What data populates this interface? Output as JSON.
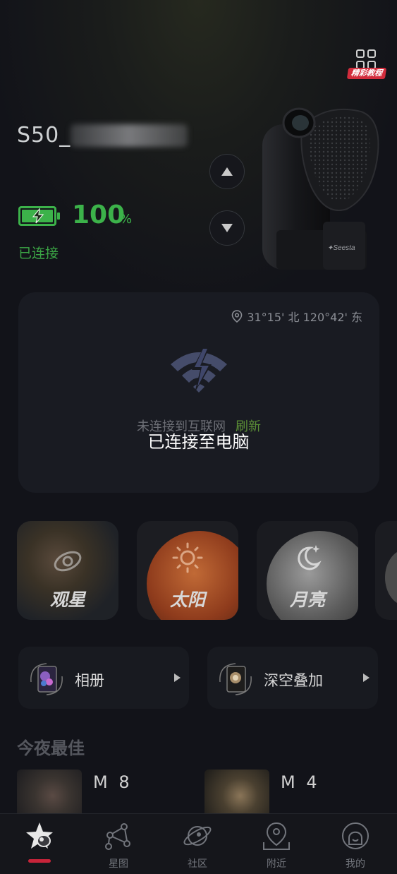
{
  "header": {
    "tutorial_label": "精彩教程",
    "device_name": "S50_",
    "battery": {
      "value": "100",
      "unit": "%",
      "level": 1.0
    },
    "connection_status": "已连接"
  },
  "network_card": {
    "location": "31°15' 北 120°42' 东",
    "message": "未连接到互联网",
    "refresh_label": "刷新"
  },
  "toast": "已连接至电脑",
  "modes": [
    {
      "label": "观星",
      "icon": "galaxy-icon"
    },
    {
      "label": "太阳",
      "icon": "sun-icon"
    },
    {
      "label": "月亮",
      "icon": "moon-icon"
    }
  ],
  "features": [
    {
      "label": "相册"
    },
    {
      "label": "深空叠加"
    }
  ],
  "best_tonight": {
    "title": "今夜最佳",
    "items": [
      {
        "name": "M 8"
      },
      {
        "name": "M 4"
      }
    ]
  },
  "tabbar": [
    {
      "label": "",
      "icon": "telescope-star-icon",
      "active": true
    },
    {
      "label": "星图",
      "icon": "constellation-icon"
    },
    {
      "label": "社区",
      "icon": "planet-icon"
    },
    {
      "label": "附近",
      "icon": "map-pin-icon"
    },
    {
      "label": "我的",
      "icon": "profile-icon"
    }
  ],
  "colors": {
    "accent_green": "#3cb24a",
    "refresh_green": "#5b8f36",
    "tab_active": "#c8243a",
    "tutorial_red": "#d22c3c"
  }
}
